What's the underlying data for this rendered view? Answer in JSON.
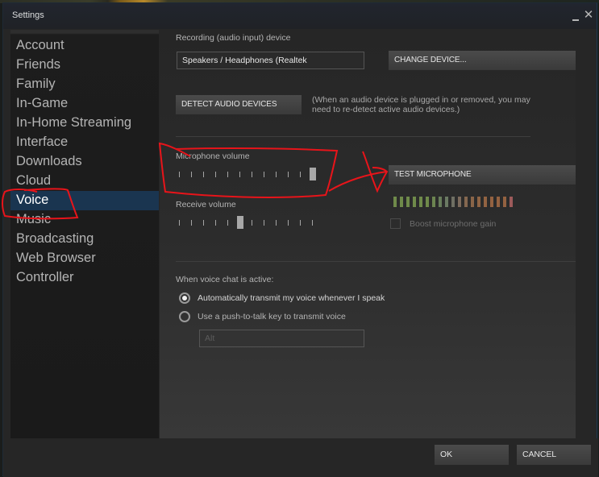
{
  "window": {
    "title": "Settings",
    "minimize_label": "_",
    "close_label": "✕"
  },
  "sidebar": {
    "items": [
      {
        "label": "Account"
      },
      {
        "label": "Friends"
      },
      {
        "label": "Family"
      },
      {
        "label": "In-Game"
      },
      {
        "label": "In-Home Streaming"
      },
      {
        "label": "Interface"
      },
      {
        "label": "Downloads"
      },
      {
        "label": "Cloud"
      },
      {
        "label": "Voice",
        "active": true
      },
      {
        "label": "Music"
      },
      {
        "label": "Broadcasting"
      },
      {
        "label": "Web Browser"
      },
      {
        "label": "Controller"
      }
    ]
  },
  "voice": {
    "recording_device_label": "Recording (audio input) device",
    "recording_device_value": "Speakers / Headphones (Realtek",
    "change_device_button": "CHANGE DEVICE...",
    "detect_button": "DETECT AUDIO DEVICES",
    "detect_hint_line1": "(When an audio device is plugged in or removed, you may",
    "detect_hint_line2": "need to re-detect active audio devices.)",
    "mic_volume_label": "Microphone volume",
    "mic_volume": {
      "steps": 12,
      "value": 12
    },
    "receive_volume_label": "Receive volume",
    "receive_volume": {
      "steps": 12,
      "value": 6
    },
    "test_mic_button": "TEST MICROPHONE",
    "level_meter": {
      "bar_count": 19,
      "colors": [
        "#6f8a4a",
        "#6f8a4a",
        "#6f8a4a",
        "#6f8a4a",
        "#6f8a4a",
        "#6f8a4a",
        "#6c8550",
        "#687d5b",
        "#6b7a63",
        "#6f6f63",
        "#7c6a5c",
        "#84674f",
        "#8a6548",
        "#8f6444",
        "#926342",
        "#946241",
        "#946241",
        "#946241",
        "#9c5a5a"
      ]
    },
    "boost_gain_label": "Boost microphone gain",
    "boost_gain_checked": false,
    "active_heading": "When voice chat is active:",
    "transmit_options": [
      {
        "label": "Automatically transmit my voice whenever I speak",
        "selected": true
      },
      {
        "label": "Use a push-to-talk key to transmit voice",
        "selected": false
      }
    ],
    "push_to_talk_key": "Alt"
  },
  "footer": {
    "ok_button": "OK",
    "cancel_button": "CANCEL"
  },
  "colors": {
    "active_nav": "#1a3550",
    "annotation": "#e8141a"
  }
}
